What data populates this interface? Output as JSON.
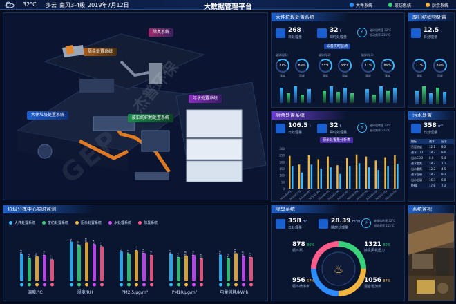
{
  "header": {
    "weather_temp": "32°C",
    "weather_cond": "多云",
    "wind": "南风3-4级",
    "date": "2019年7月12日",
    "title": "大数据管理平台",
    "tabs": [
      {
        "label": "大件系统",
        "color": "#2d8cff"
      },
      {
        "label": "废纺系统",
        "color": "#39d27a"
      },
      {
        "label": "厨余系统",
        "color": "#f2b640"
      }
    ]
  },
  "scene": {
    "labels": {
      "deodor": "除臭系统",
      "kitchen": "厨余处置系统",
      "bulky": "大件垃圾处置系统",
      "textile": "废旧纺织物处置系统",
      "sewage": "污水处置系统"
    },
    "watermark": "杰普环保"
  },
  "bulky_panel": {
    "title": "大件垃圾处置系统",
    "stat1_value": "268",
    "stat1_unit": "t",
    "stat1_label": "日处理量",
    "stat2_value": "32",
    "stat2_unit": "t",
    "stat2_label": "瞬时处理量",
    "status_line1": "破碎机转速 32°C",
    "status_line2": "振动频率 215°C",
    "badge": "设备实时监测",
    "gauges": [
      {
        "value": "77%",
        "label": "温度"
      },
      {
        "value": "89%",
        "label": "湿度"
      },
      {
        "value": "33°C",
        "label": "温度"
      },
      {
        "value": "38°C",
        "label": "温度"
      },
      {
        "value": "77%",
        "label": "温度"
      },
      {
        "value": "89%",
        "label": "湿度"
      }
    ]
  },
  "textile_panel": {
    "title": "废旧纺织物处置",
    "stat_value": "12.5",
    "stat_unit": "t",
    "stat_label": "日处理量",
    "gauges": [
      {
        "value": "77%",
        "label": "温度"
      },
      {
        "value": "89%",
        "label": "湿度"
      }
    ]
  },
  "kitchen_panel": {
    "title": "厨余处置系统",
    "stat1_value": "106.5",
    "stat1_unit": "t",
    "stat1_label": "日处理量",
    "stat2_value": "32",
    "stat2_unit": "t",
    "stat2_label": "瞬时处理量",
    "status_line1": "破碎机转速 32°C",
    "status_line2": "振动频率 215°C",
    "badge": "厨余处置量分析表",
    "yticks": [
      "300",
      "250",
      "200",
      "150",
      "100",
      "50",
      "0"
    ],
    "chart_data": {
      "type": "bar",
      "categories": [
        "2019/07/01",
        "2019/07/02",
        "2019/07/03",
        "2019/07/04",
        "2019/07/05",
        "2019/07/06",
        "2019/07/07",
        "2019/07/08",
        "2019/07/09",
        "2019/07/10",
        "2019/07/11",
        "2019/07/12"
      ],
      "series": [
        {
          "values": [
            245,
            180,
            250,
            220,
            240,
            175,
            230,
            255,
            240,
            210,
            235,
            250
          ]
        },
        {
          "values": [
            170,
            120,
            180,
            150,
            160,
            110,
            170,
            190,
            160,
            140,
            170,
            185
          ]
        }
      ],
      "ylim": [
        0,
        300
      ]
    }
  },
  "sewage_panel": {
    "title": "污水处置",
    "stat_value": "358",
    "stat_unit": "m³",
    "stat_label": "日处理量",
    "col_headers": [
      "指标",
      "进水",
      "出水"
    ],
    "rows": [
      {
        "name": "污泥浓度",
        "a": "12.1",
        "b": "8.2"
      },
      {
        "name": "进水COD",
        "a": "18.2",
        "b": "9.0"
      },
      {
        "name": "出水COD",
        "a": "8.6",
        "b": "5.4"
      },
      {
        "name": "进水氨氮",
        "a": "18.2",
        "b": "7.1"
      },
      {
        "name": "出水氨氮",
        "a": "12.2",
        "b": "4.5"
      },
      {
        "name": "进水总磷",
        "a": "18.2",
        "b": "9.3"
      },
      {
        "name": "出水总磷",
        "a": "16.3",
        "b": "6.8"
      },
      {
        "name": "PH值",
        "a": "17.8",
        "b": "7.2"
      }
    ]
  },
  "monitor_panel": {
    "title": "垃圾分拣中心实时监测",
    "legend": [
      {
        "label": "大件处置系统",
        "color": "#37b8ff"
      },
      {
        "label": "废纺处置系统",
        "color": "#39d27a"
      },
      {
        "label": "厨余处置系统",
        "color": "#f2b640"
      },
      {
        "label": "水处理系统",
        "color": "#d04cff"
      },
      {
        "label": "除臭系统",
        "color": "#ff5c8a"
      }
    ],
    "chart_data": {
      "type": "bar",
      "categories": [
        "温度/°C",
        "湿度/RH",
        "PM2.5/μg/m³",
        "PM10/μg/m³",
        "电量消耗/kW·h"
      ],
      "series": [
        {
          "name": "大件处置系统",
          "values": [
            28.3,
            41.0,
            31.0,
            28.2,
            27.5
          ]
        },
        {
          "name": "废纺处置系统",
          "values": [
            24.2,
            37.2,
            28.2,
            25.1,
            24.3
          ]
        },
        {
          "name": "厨余处置系统",
          "values": [
            26.0,
            40.5,
            32.1,
            26.8,
            29.1
          ]
        },
        {
          "name": "水处理系统",
          "values": [
            27.3,
            38.4,
            29.4,
            27.3,
            26.6
          ]
        },
        {
          "name": "除臭系统",
          "values": [
            22.7,
            36.2,
            27.2,
            23.9,
            25.2
          ]
        }
      ],
      "ylim": [
        0,
        50
      ]
    }
  },
  "deodor_panel": {
    "title": "除臭系统",
    "stat1_value": "358",
    "stat1_unit": "m³",
    "stat1_label": "日处理量",
    "stat2_value": "28.39",
    "stat2_unit": "m³/h",
    "stat2_label": "瞬时处理量",
    "status_line1": "破碎机转速 32°C",
    "status_line2": "振动频率 215°C",
    "quadrants": [
      {
        "value": "878",
        "pct": "86%",
        "label": "循环泵"
      },
      {
        "value": "1321",
        "pct": "80%",
        "label": "除臭风机压力"
      },
      {
        "value": "956",
        "pct": "67%",
        "label": "循环喷淋水"
      },
      {
        "value": "1056",
        "pct": "87%",
        "label": "混合箱加热"
      }
    ]
  },
  "video_panel": {
    "title": "系统监视"
  }
}
